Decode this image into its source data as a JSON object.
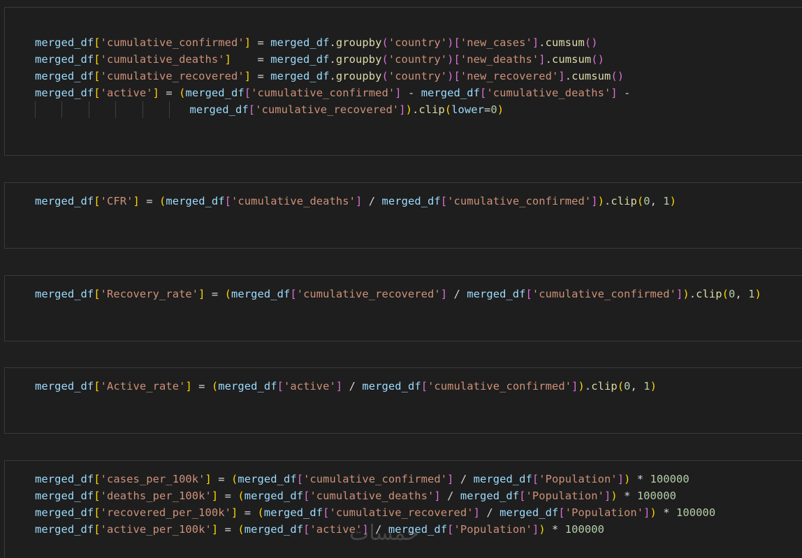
{
  "cells": [
    {
      "lines": [
        [
          [
            "v",
            "merged_df"
          ],
          [
            "b1",
            "["
          ],
          [
            "s",
            "'cumulative_confirmed'"
          ],
          [
            "b1",
            "]"
          ],
          [
            "p",
            " = "
          ],
          [
            "v",
            "merged_df"
          ],
          [
            "p",
            "."
          ],
          [
            "f",
            "groupby"
          ],
          [
            "b2",
            "("
          ],
          [
            "s",
            "'country'"
          ],
          [
            "b2",
            ")"
          ],
          [
            "b2",
            "["
          ],
          [
            "s",
            "'new_cases'"
          ],
          [
            "b2",
            "]"
          ],
          [
            "p",
            "."
          ],
          [
            "f",
            "cumsum"
          ],
          [
            "b2",
            "()"
          ]
        ],
        [
          [
            "v",
            "merged_df"
          ],
          [
            "b1",
            "["
          ],
          [
            "s",
            "'cumulative_deaths'"
          ],
          [
            "b1",
            "]"
          ],
          [
            "p",
            "    = "
          ],
          [
            "v",
            "merged_df"
          ],
          [
            "p",
            "."
          ],
          [
            "f",
            "groupby"
          ],
          [
            "b2",
            "("
          ],
          [
            "s",
            "'country'"
          ],
          [
            "b2",
            ")"
          ],
          [
            "b2",
            "["
          ],
          [
            "s",
            "'new_deaths'"
          ],
          [
            "b2",
            "]"
          ],
          [
            "p",
            "."
          ],
          [
            "f",
            "cumsum"
          ],
          [
            "b2",
            "()"
          ]
        ],
        [
          [
            "v",
            "merged_df"
          ],
          [
            "b1",
            "["
          ],
          [
            "s",
            "'cumulative_recovered'"
          ],
          [
            "b1",
            "]"
          ],
          [
            "p",
            " = "
          ],
          [
            "v",
            "merged_df"
          ],
          [
            "p",
            "."
          ],
          [
            "f",
            "groupby"
          ],
          [
            "b2",
            "("
          ],
          [
            "s",
            "'country'"
          ],
          [
            "b2",
            ")"
          ],
          [
            "b2",
            "["
          ],
          [
            "s",
            "'new_recovered'"
          ],
          [
            "b2",
            "]"
          ],
          [
            "p",
            "."
          ],
          [
            "f",
            "cumsum"
          ],
          [
            "b2",
            "()"
          ]
        ],
        [
          [
            "v",
            "merged_df"
          ],
          [
            "b1",
            "["
          ],
          [
            "s",
            "'active'"
          ],
          [
            "b1",
            "]"
          ],
          [
            "p",
            " = "
          ],
          [
            "b1",
            "("
          ],
          [
            "v",
            "merged_df"
          ],
          [
            "b2",
            "["
          ],
          [
            "s",
            "'cumulative_confirmed'"
          ],
          [
            "b2",
            "]"
          ],
          [
            "p",
            " - "
          ],
          [
            "v",
            "merged_df"
          ],
          [
            "b2",
            "["
          ],
          [
            "s",
            "'cumulative_deaths'"
          ],
          [
            "b2",
            "]"
          ],
          [
            "p",
            " -"
          ]
        ],
        [
          [
            "g",
            ""
          ],
          [
            "p",
            "    "
          ],
          [
            "g",
            ""
          ],
          [
            "p",
            "    "
          ],
          [
            "g",
            ""
          ],
          [
            "p",
            "    "
          ],
          [
            "g",
            ""
          ],
          [
            "p",
            "    "
          ],
          [
            "g",
            ""
          ],
          [
            "p",
            "    "
          ],
          [
            "g",
            ""
          ],
          [
            "p",
            "   "
          ],
          [
            "v",
            "merged_df"
          ],
          [
            "b2",
            "["
          ],
          [
            "s",
            "'cumulative_recovered'"
          ],
          [
            "b2",
            "]"
          ],
          [
            "b1",
            ")"
          ],
          [
            "p",
            "."
          ],
          [
            "f",
            "clip"
          ],
          [
            "b1",
            "("
          ],
          [
            "v",
            "lower"
          ],
          [
            "p",
            "="
          ],
          [
            "n",
            "0"
          ],
          [
            "b1",
            ")"
          ]
        ]
      ]
    },
    {
      "lines": [
        [
          [
            "v",
            "merged_df"
          ],
          [
            "b1",
            "["
          ],
          [
            "s",
            "'CFR'"
          ],
          [
            "b1",
            "]"
          ],
          [
            "p",
            " = "
          ],
          [
            "b1",
            "("
          ],
          [
            "v",
            "merged_df"
          ],
          [
            "b2",
            "["
          ],
          [
            "s",
            "'cumulative_deaths'"
          ],
          [
            "b2",
            "]"
          ],
          [
            "p",
            " / "
          ],
          [
            "v",
            "merged_df"
          ],
          [
            "b2",
            "["
          ],
          [
            "s",
            "'cumulative_confirmed'"
          ],
          [
            "b2",
            "]"
          ],
          [
            "b1",
            ")"
          ],
          [
            "p",
            "."
          ],
          [
            "f",
            "clip"
          ],
          [
            "b1",
            "("
          ],
          [
            "n",
            "0"
          ],
          [
            "p",
            ", "
          ],
          [
            "n",
            "1"
          ],
          [
            "b1",
            ")"
          ]
        ]
      ]
    },
    {
      "lines": [
        [
          [
            "v",
            "merged_df"
          ],
          [
            "b1",
            "["
          ],
          [
            "s",
            "'Recovery_rate'"
          ],
          [
            "b1",
            "]"
          ],
          [
            "p",
            " = "
          ],
          [
            "b1",
            "("
          ],
          [
            "v",
            "merged_df"
          ],
          [
            "b2",
            "["
          ],
          [
            "s",
            "'cumulative_recovered'"
          ],
          [
            "b2",
            "]"
          ],
          [
            "p",
            " / "
          ],
          [
            "v",
            "merged_df"
          ],
          [
            "b2",
            "["
          ],
          [
            "s",
            "'cumulative_confirmed'"
          ],
          [
            "b2",
            "]"
          ],
          [
            "b1",
            ")"
          ],
          [
            "p",
            "."
          ],
          [
            "f",
            "clip"
          ],
          [
            "b1",
            "("
          ],
          [
            "n",
            "0"
          ],
          [
            "p",
            ", "
          ],
          [
            "n",
            "1"
          ],
          [
            "b1",
            ")"
          ]
        ]
      ]
    },
    {
      "lines": [
        [
          [
            "v",
            "merged_df"
          ],
          [
            "b1",
            "["
          ],
          [
            "s",
            "'Active_rate'"
          ],
          [
            "b1",
            "]"
          ],
          [
            "p",
            " = "
          ],
          [
            "b1",
            "("
          ],
          [
            "v",
            "merged_df"
          ],
          [
            "b2",
            "["
          ],
          [
            "s",
            "'active'"
          ],
          [
            "b2",
            "]"
          ],
          [
            "p",
            " / "
          ],
          [
            "v",
            "merged_df"
          ],
          [
            "b2",
            "["
          ],
          [
            "s",
            "'cumulative_confirmed'"
          ],
          [
            "b2",
            "]"
          ],
          [
            "b1",
            ")"
          ],
          [
            "p",
            "."
          ],
          [
            "f",
            "clip"
          ],
          [
            "b1",
            "("
          ],
          [
            "n",
            "0"
          ],
          [
            "p",
            ", "
          ],
          [
            "n",
            "1"
          ],
          [
            "b1",
            ")"
          ]
        ]
      ]
    },
    {
      "lines": [
        [
          [
            "v",
            "merged_df"
          ],
          [
            "b1",
            "["
          ],
          [
            "s",
            "'cases_per_100k'"
          ],
          [
            "b1",
            "]"
          ],
          [
            "p",
            " = "
          ],
          [
            "b1",
            "("
          ],
          [
            "v",
            "merged_df"
          ],
          [
            "b2",
            "["
          ],
          [
            "s",
            "'cumulative_confirmed'"
          ],
          [
            "b2",
            "]"
          ],
          [
            "p",
            " / "
          ],
          [
            "v",
            "merged_df"
          ],
          [
            "b2",
            "["
          ],
          [
            "s",
            "'Population'"
          ],
          [
            "b2",
            "]"
          ],
          [
            "b1",
            ")"
          ],
          [
            "p",
            " * "
          ],
          [
            "n",
            "100000"
          ]
        ],
        [
          [
            "v",
            "merged_df"
          ],
          [
            "b1",
            "["
          ],
          [
            "s",
            "'deaths_per_100k'"
          ],
          [
            "b1",
            "]"
          ],
          [
            "p",
            " = "
          ],
          [
            "b1",
            "("
          ],
          [
            "v",
            "merged_df"
          ],
          [
            "b2",
            "["
          ],
          [
            "s",
            "'cumulative_deaths'"
          ],
          [
            "b2",
            "]"
          ],
          [
            "p",
            " / "
          ],
          [
            "v",
            "merged_df"
          ],
          [
            "b2",
            "["
          ],
          [
            "s",
            "'Population'"
          ],
          [
            "b2",
            "]"
          ],
          [
            "b1",
            ")"
          ],
          [
            "p",
            " * "
          ],
          [
            "n",
            "100000"
          ]
        ],
        [
          [
            "v",
            "merged_df"
          ],
          [
            "b1",
            "["
          ],
          [
            "s",
            "'recovered_per_100k'"
          ],
          [
            "b1",
            "]"
          ],
          [
            "p",
            " = "
          ],
          [
            "b1",
            "("
          ],
          [
            "v",
            "merged_df"
          ],
          [
            "b2",
            "["
          ],
          [
            "s",
            "'cumulative_recovered'"
          ],
          [
            "b2",
            "]"
          ],
          [
            "p",
            " / "
          ],
          [
            "v",
            "merged_df"
          ],
          [
            "b2",
            "["
          ],
          [
            "s",
            "'Population'"
          ],
          [
            "b2",
            "]"
          ],
          [
            "b1",
            ")"
          ],
          [
            "p",
            " * "
          ],
          [
            "n",
            "100000"
          ]
        ],
        [
          [
            "v",
            "merged_df"
          ],
          [
            "b1",
            "["
          ],
          [
            "s",
            "'active_per_100k'"
          ],
          [
            "b1",
            "]"
          ],
          [
            "p",
            " = "
          ],
          [
            "b1",
            "("
          ],
          [
            "v",
            "merged_df"
          ],
          [
            "b2",
            "["
          ],
          [
            "s",
            "'active'"
          ],
          [
            "b2",
            "]"
          ],
          [
            "p",
            " / "
          ],
          [
            "v",
            "merged_df"
          ],
          [
            "b2",
            "["
          ],
          [
            "s",
            "'Population'"
          ],
          [
            "b2",
            "]"
          ],
          [
            "b1",
            ")"
          ],
          [
            "p",
            " * "
          ],
          [
            "n",
            "100000"
          ]
        ]
      ]
    }
  ],
  "watermark": "خمسات"
}
